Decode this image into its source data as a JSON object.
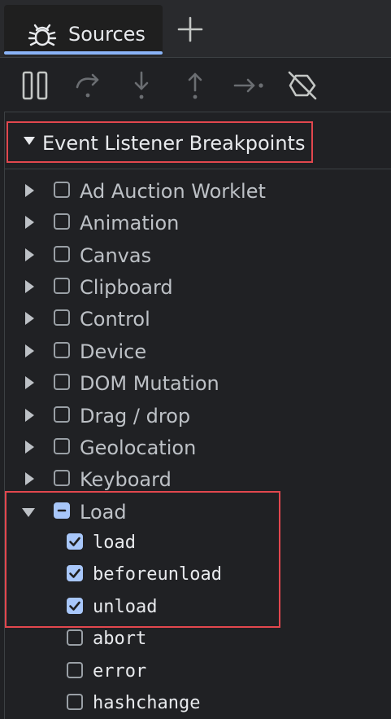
{
  "tab": {
    "label": "Sources",
    "icon": "bug-icon",
    "add_icon": "plus-icon"
  },
  "toolbar": {
    "buttons": [
      {
        "name": "pause-resume-button",
        "icon": "pause-icon"
      },
      {
        "name": "step-over-button",
        "icon": "step-over-icon"
      },
      {
        "name": "step-into-button",
        "icon": "step-into-icon"
      },
      {
        "name": "step-out-button",
        "icon": "step-out-icon"
      },
      {
        "name": "step-button",
        "icon": "step-icon"
      },
      {
        "name": "deactivate-breakpoints-button",
        "icon": "deactivate-breakpoints-icon"
      }
    ]
  },
  "section": {
    "title": "Event Listener Breakpoints",
    "expanded": true
  },
  "categories": [
    {
      "label": "Ad Auction Worklet",
      "checked": false,
      "expanded": false
    },
    {
      "label": "Animation",
      "checked": false,
      "expanded": false
    },
    {
      "label": "Canvas",
      "checked": false,
      "expanded": false
    },
    {
      "label": "Clipboard",
      "checked": false,
      "expanded": false
    },
    {
      "label": "Control",
      "checked": false,
      "expanded": false
    },
    {
      "label": "Device",
      "checked": false,
      "expanded": false
    },
    {
      "label": "DOM Mutation",
      "checked": false,
      "expanded": false
    },
    {
      "label": "Drag / drop",
      "checked": false,
      "expanded": false
    },
    {
      "label": "Geolocation",
      "checked": false,
      "expanded": false
    },
    {
      "label": "Keyboard",
      "checked": false,
      "expanded": false
    },
    {
      "label": "Load",
      "checked": "mixed",
      "expanded": true
    }
  ],
  "load_events": [
    {
      "label": "load",
      "checked": true
    },
    {
      "label": "beforeunload",
      "checked": true
    },
    {
      "label": "unload",
      "checked": true
    },
    {
      "label": "abort",
      "checked": false
    },
    {
      "label": "error",
      "checked": false
    },
    {
      "label": "hashchange",
      "checked": false
    }
  ],
  "colors": {
    "accent": "#8ab4f8",
    "checkbox_checked": "#a8c7fa",
    "highlight": "#e2474e",
    "background": "#202124"
  }
}
